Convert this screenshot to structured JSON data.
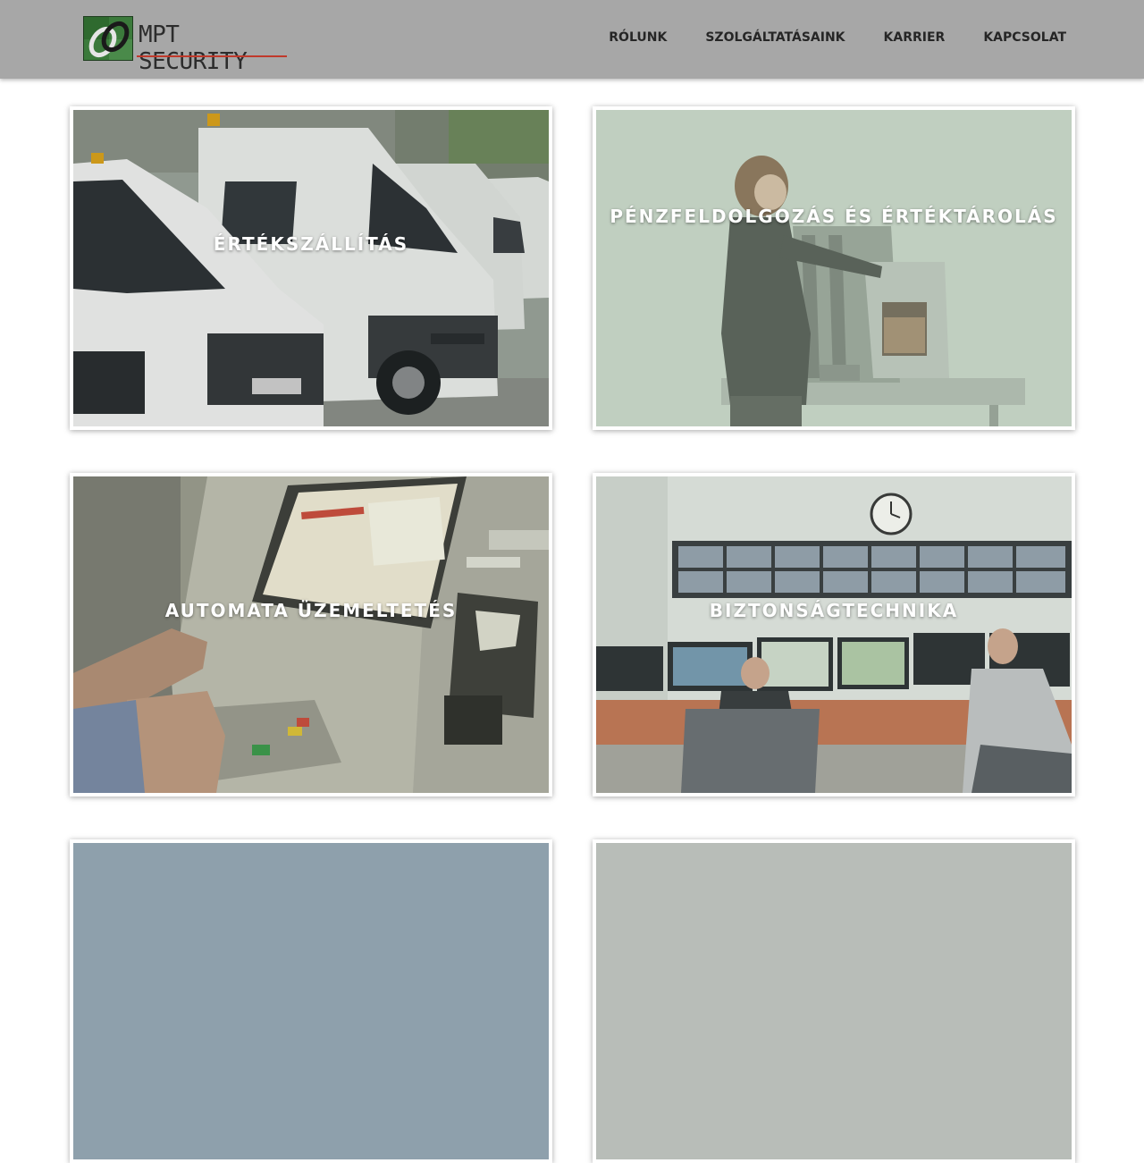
{
  "brand": {
    "name": "MPT SECURITY",
    "colors": {
      "header_bg": "#a7a7a7",
      "logo_green": "#3b7a3b",
      "logo_red": "#c0392b",
      "tile_overlay": "#b9ccb9"
    }
  },
  "nav": {
    "items": [
      {
        "label": "RÓLUNK"
      },
      {
        "label": "SZOLGÁLTATÁSAINK"
      },
      {
        "label": "KARRIER"
      },
      {
        "label": "KAPCSOLAT"
      }
    ]
  },
  "services": [
    {
      "title": "ÉRTÉKSZÁLLÍTÁS",
      "image": "vans-photo"
    },
    {
      "title": "PÉNZFELDOLGOZÁS ÉS ÉRTÉKTÁROLÁS",
      "image": "cash-processing-photo"
    },
    {
      "title": "AUTOMATA ÜZEMELTETÉS",
      "image": "atm-photo"
    },
    {
      "title": "BIZTONSÁGTECHNIKA",
      "image": "control-room-photo"
    },
    {
      "title": "",
      "image": "partial-photo"
    },
    {
      "title": "",
      "image": "partial-photo"
    }
  ]
}
